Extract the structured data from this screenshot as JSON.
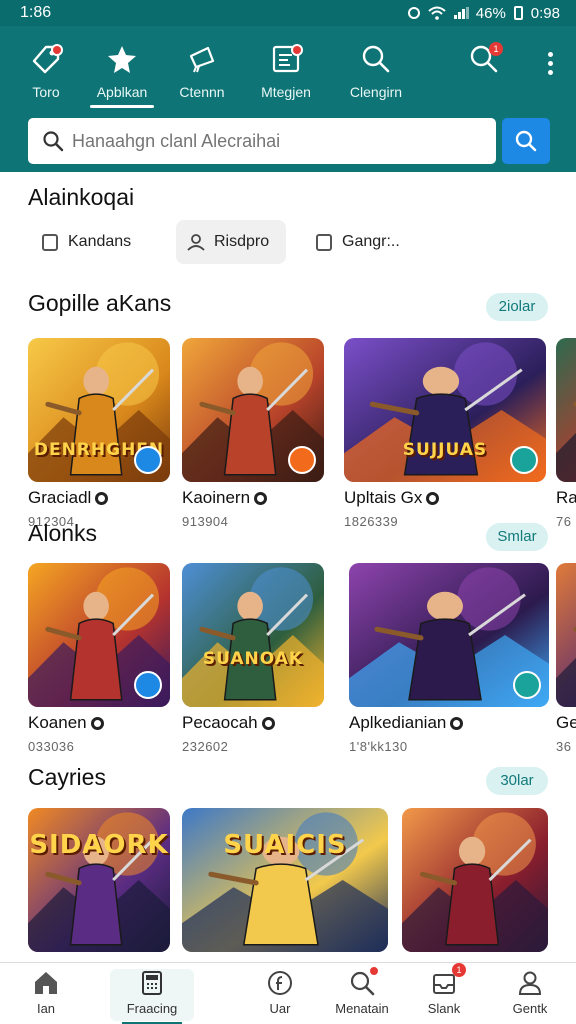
{
  "status": {
    "time": "1:86",
    "battery": "46%",
    "clock": "0:98"
  },
  "topnav": {
    "items": [
      {
        "label": "Toro",
        "icon": "tag-icon",
        "badge": ""
      },
      {
        "label": "Apblkan",
        "icon": "star-icon",
        "badge": ""
      },
      {
        "label": "Ctennn",
        "icon": "megaphone-icon",
        "badge": ""
      },
      {
        "label": "Mtegjen",
        "icon": "document-icon",
        "badge": "dot"
      },
      {
        "label": "Clengirn",
        "icon": "search-icon",
        "badge": ""
      }
    ],
    "search_icon_badge": "1"
  },
  "search": {
    "placeholder": "Hanaahgn clanl Alecraihai",
    "value": ""
  },
  "filters": {
    "title": "Alainkoqai",
    "chips": [
      {
        "label": "Kandans",
        "icon": "checkbox-icon"
      },
      {
        "label": "Risdpro",
        "icon": "person-icon"
      },
      {
        "label": "Gangr:..",
        "icon": "checkbox-icon"
      }
    ]
  },
  "sections": [
    {
      "title": "Gopille aKans",
      "more": "2iolar",
      "cards": [
        {
          "name": "Graciadl",
          "count": "912304",
          "art": "DENRHGHEN",
          "palette": [
            "#f7c948",
            "#d9881b",
            "#7a3b0c"
          ]
        },
        {
          "name": "Kaoinern",
          "count": "913904",
          "art": "",
          "palette": [
            "#f0a63a",
            "#b8432a",
            "#3b1c14"
          ]
        },
        {
          "name": "Upltais Gx",
          "count": "1826339",
          "art": "SUJJUAS",
          "palette": [
            "#7b4fc9",
            "#2b1f5a",
            "#f26b1d"
          ]
        },
        {
          "name": "Ra",
          "count": "76",
          "art": "",
          "palette": [
            "#2d6a4f",
            "#c0392b",
            "#1b1b2f"
          ]
        }
      ]
    },
    {
      "title": "Alonks",
      "more": "Smlar",
      "cards": [
        {
          "name": "Koanen",
          "count": "033036",
          "art": "",
          "palette": [
            "#f5a623",
            "#b5332e",
            "#3a1b5c"
          ]
        },
        {
          "name": "Pecaocah",
          "count": "232602",
          "art": "SUANOAK",
          "palette": [
            "#4e8fd6",
            "#2e5e3e",
            "#f0b22e"
          ]
        },
        {
          "name": "Aplkedianian",
          "count": "1'8'kk130",
          "art": "",
          "palette": [
            "#8e44ad",
            "#2c1a4d",
            "#3fa9f5"
          ]
        },
        {
          "name": "Ge",
          "count": "36",
          "art": "",
          "palette": [
            "#e07b39",
            "#5b2c6f",
            "#1c1c3a"
          ]
        }
      ]
    },
    {
      "title": "Cayries",
      "more": "30lar",
      "cards": [
        {
          "name": "",
          "count": "",
          "art": "SIDAORK",
          "palette": [
            "#f08a24",
            "#5b2c83",
            "#1b1b3a"
          ]
        },
        {
          "name": "",
          "count": "",
          "art": "SUAICIS",
          "palette": [
            "#3d78c7",
            "#f2c94c",
            "#1e2e5a"
          ]
        },
        {
          "name": "",
          "count": "",
          "art": "",
          "palette": [
            "#f2994a",
            "#8b1e2d",
            "#2b1a3a"
          ]
        }
      ]
    }
  ],
  "bottomnav": {
    "items": [
      {
        "label": "Ian",
        "icon": "home-icon",
        "badge": ""
      },
      {
        "label": "Fraacing",
        "icon": "calculator-icon",
        "badge": ""
      },
      {
        "label": "Uar",
        "icon": "circle-f-icon",
        "badge": ""
      },
      {
        "label": "Menatain",
        "icon": "search-icon",
        "badge": "dot"
      },
      {
        "label": "Slank",
        "icon": "tray-icon",
        "badge": "1"
      },
      {
        "label": "Gentk",
        "icon": "person-icon",
        "badge": ""
      }
    ]
  }
}
